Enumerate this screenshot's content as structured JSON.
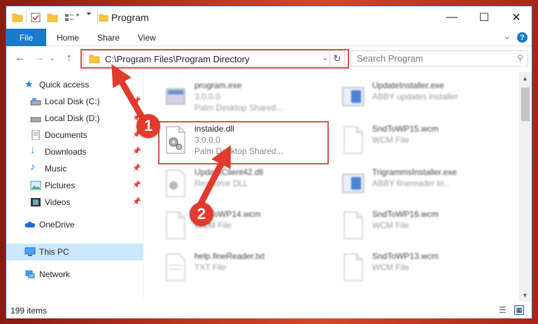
{
  "window": {
    "title": "Program",
    "controls": {
      "minimize": "—",
      "maximize": "☐",
      "close": "✕"
    }
  },
  "ribbon": {
    "tabs": [
      "File",
      "Home",
      "Share",
      "View"
    ],
    "help": "?",
    "expand": "⌄"
  },
  "address": {
    "path": "C:\\Program Files\\Program Directory",
    "search_placeholder": "Search Program"
  },
  "sidebar": {
    "items": [
      {
        "label": "Quick access",
        "icon": "star-icon",
        "pinned": false
      },
      {
        "label": "Local Disk (C:)",
        "icon": "drive-icon",
        "pinned": true
      },
      {
        "label": "Local Disk (D:)",
        "icon": "drive-icon",
        "pinned": true
      },
      {
        "label": "Documents",
        "icon": "documents-icon",
        "pinned": true
      },
      {
        "label": "Downloads",
        "icon": "download-icon",
        "pinned": true
      },
      {
        "label": "Music",
        "icon": "music-icon",
        "pinned": true
      },
      {
        "label": "Pictures",
        "icon": "pictures-icon",
        "pinned": true
      },
      {
        "label": "Videos",
        "icon": "videos-icon",
        "pinned": true
      },
      {
        "label": "OneDrive",
        "icon": "cloud-icon",
        "pinned": false
      },
      {
        "label": "This PC",
        "icon": "pc-icon",
        "pinned": false,
        "selected": true
      },
      {
        "label": "Network",
        "icon": "network-icon",
        "pinned": false
      }
    ]
  },
  "files": [
    {
      "name": "program.exe",
      "line2": "3.0.0.0",
      "line3": "Palm Desktop Shared...",
      "icon": "exe-icon"
    },
    {
      "name": "UpdateInstaller.exe",
      "line2": "ABBY updates installer",
      "line3": "",
      "icon": "installer-icon"
    },
    {
      "name": "instaide.dll",
      "line2": "3.0.0.0",
      "line3": "Palm Desktop Shared...",
      "icon": "dll-gear-icon"
    },
    {
      "name": "SndToWP15.wcm",
      "line2": "WCM File",
      "line3": "",
      "icon": "blank-file-icon"
    },
    {
      "name": "UpdateClient42.dll",
      "line2": "Resource DLL",
      "line3": "",
      "icon": "dll-gear-icon"
    },
    {
      "name": "TrigrammsInstaller.exe",
      "line2": "ABBY finereader tri...",
      "line3": "",
      "icon": "installer-icon"
    },
    {
      "name": "SndToWP14.wcm",
      "line2": "WCM File",
      "line3": "",
      "icon": "blank-file-icon"
    },
    {
      "name": "SndToWP16.wcm",
      "line2": "WCM File",
      "line3": "",
      "icon": "blank-file-icon"
    },
    {
      "name": "help.fineReader.txt",
      "line2": "TXT File",
      "line3": "",
      "icon": "text-file-icon"
    },
    {
      "name": "SndToWP13.wcm",
      "line2": "WCM File",
      "line3": "",
      "icon": "blank-file-icon"
    }
  ],
  "status": {
    "items_count": "199 items"
  },
  "callouts": [
    "1",
    "2"
  ],
  "colors": {
    "accent": "#1979ca",
    "highlight": "#d9534f",
    "badge": "#e23a2c",
    "selected": "#cce8ff"
  }
}
